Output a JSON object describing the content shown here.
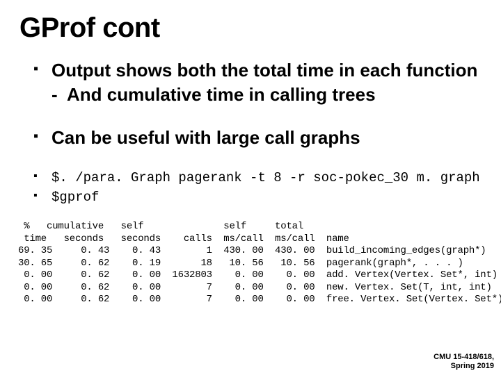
{
  "title": "GProf cont",
  "bullets": [
    {
      "text": "Output shows both the total time in each function",
      "sub": [
        "And cumulative time in calling trees"
      ]
    },
    {
      "text": "Can be useful with large call graphs",
      "sub": []
    }
  ],
  "code_lines": [
    "$. /para. Graph pagerank -t 8 -r soc-pokec_30 m. graph",
    "$gprof"
  ],
  "table_header1": " %   cumulative   self              self     total           ",
  "table_header2": " time   seconds   seconds    calls  ms/call  ms/call  name    ",
  "table_rows": [
    "69. 35     0. 43    0. 43        1  430. 00  430. 00  build_incoming_edges(graph*)",
    "30. 65     0. 62    0. 19       18   10. 56   10. 56  pagerank(graph*, . . . )",
    " 0. 00     0. 62    0. 00  1632803    0. 00    0. 00  add. Vertex(Vertex. Set*, int)",
    " 0. 00     0. 62    0. 00        7    0. 00    0. 00  new. Vertex. Set(T, int, int)",
    " 0. 00     0. 62    0. 00        7    0. 00    0. 00  free. Vertex. Set(Vertex. Set*)"
  ],
  "footer_line1": "CMU 15-418/618,",
  "footer_line2": "Spring 2019"
}
